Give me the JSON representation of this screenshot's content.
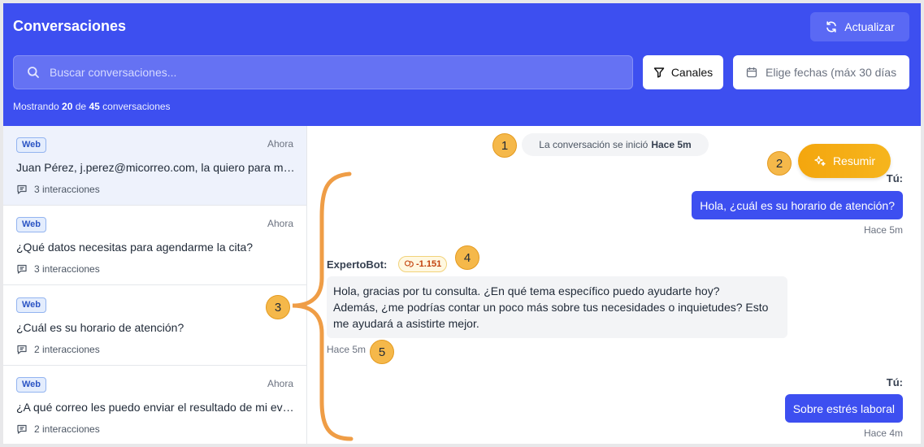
{
  "header": {
    "title": "Conversaciones",
    "refresh_label": "Actualizar",
    "search_placeholder": "Buscar conversaciones...",
    "channels_label": "Canales",
    "dates_placeholder": "Elige fechas (máx 30 días",
    "count_prefix": "Mostrando",
    "count_shown": "20",
    "count_mid": "de",
    "count_total": "45",
    "count_suffix": "conversaciones"
  },
  "conversations": [
    {
      "channel": "Web",
      "time": "Ahora",
      "text": "Juan Pérez, j.perez@micorreo.com, la quiero para mañana",
      "interactions": "3 interacciones"
    },
    {
      "channel": "Web",
      "time": "Ahora",
      "text": "¿Qué datos necesitas para agendarme la cita?",
      "interactions": "3 interacciones"
    },
    {
      "channel": "Web",
      "time": "",
      "text": "¿Cuál es su horario de atención?",
      "interactions": "2 interacciones"
    },
    {
      "channel": "Web",
      "time": "Ahora",
      "text": "¿A qué correo les puedo enviar el resultado de mi evaluación?",
      "interactions": "2 interacciones"
    }
  ],
  "chat": {
    "start_text": "La conversación se inició",
    "start_when": "Hace 5m",
    "summary_label": "Resumir",
    "messages": [
      {
        "author": "Tú:",
        "text": "Hola, ¿cuál es su horario de atención?",
        "time": "Hace 5m"
      },
      {
        "author": "ExpertoBot:",
        "cost": "-1.151",
        "lines": [
          "Hola, gracias por tu consulta. ¿En qué tema específico puedo ayudarte hoy?",
          "Además, ¿me podrías contar un poco más sobre tus necesidades o inquietudes? Esto",
          "me ayudará a asistirte mejor."
        ],
        "time": "Hace 5m"
      },
      {
        "author": "Tú:",
        "text": "Sobre estrés laboral",
        "time": "Hace 4m"
      }
    ]
  },
  "annotations": {
    "m1": "1",
    "m2": "2",
    "m3": "3",
    "m4": "4",
    "m5": "5"
  },
  "colors": {
    "primary": "#3d4ff0",
    "accent": "#f4a60e",
    "marker": "#f5b84a"
  }
}
